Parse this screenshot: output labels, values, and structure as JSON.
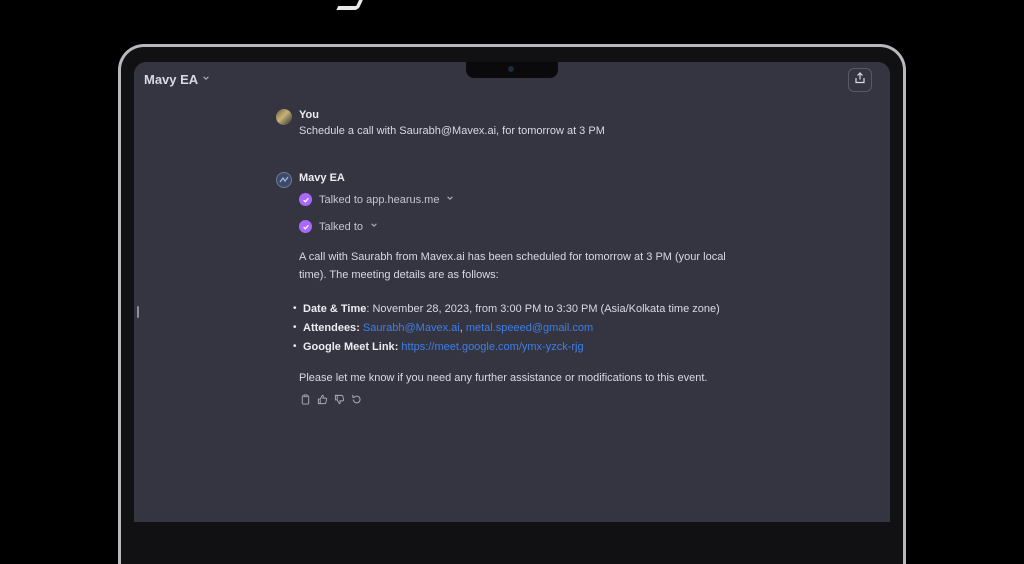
{
  "window": {
    "title": "Mavy EA"
  },
  "user_message": {
    "author": "You",
    "text": "Schedule a call with Saurabh@Mavex.ai, for tomorrow at 3 PM"
  },
  "assistant_message": {
    "author": "Mavy EA",
    "tools": [
      {
        "label": "Talked to app.hearus.me"
      },
      {
        "label": "Talked to"
      }
    ],
    "intro": "A call with Saurabh from Mavex.ai has been scheduled for tomorrow at 3 PM (your local time). The meeting details are as follows:",
    "details": {
      "date_label": "Date & Time",
      "date_value": ": November 28, 2023, from 3:00 PM to 3:30 PM (Asia/Kolkata time zone)",
      "attendees_label": "Attendees",
      "attendee_1": "Saurabh@Mavex.ai",
      "attendee_sep": ",",
      "attendee_2": "metal.speeed@gmail.com",
      "meet_label": "Google Meet Link",
      "meet_link": "https://meet.google.com/ymx-yzck-rjg"
    },
    "closing": "Please let me know if you need any further assistance or modifications to this event."
  },
  "colors": {
    "background": "#000000",
    "chat_bg": "#343541",
    "accent_check": "#ab68ff",
    "link": "#3e7ee6"
  },
  "icons": [
    "share-icon",
    "chevron-down-icon",
    "check-icon",
    "copy-icon",
    "thumbs-up-icon",
    "thumbs-down-icon",
    "regenerate-icon"
  ]
}
